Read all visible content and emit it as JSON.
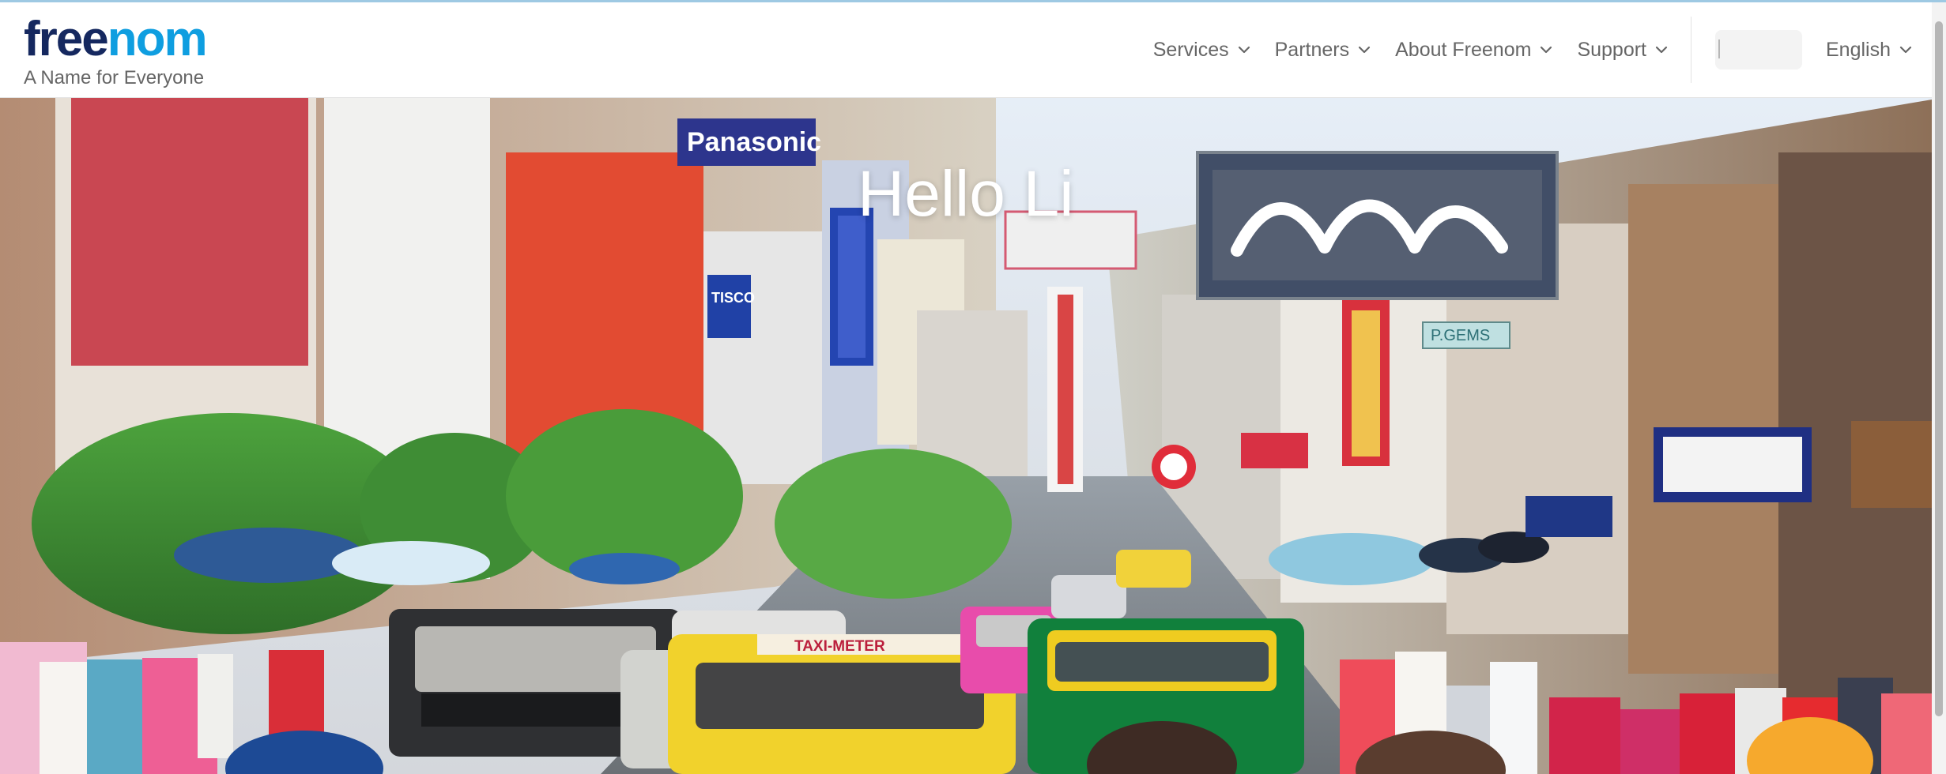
{
  "header": {
    "logo": {
      "part1": "free",
      "part2": "nom"
    },
    "tagline": "A Name for Everyone",
    "nav": {
      "items": [
        {
          "label": "Services",
          "icon": "chevron-down-icon"
        },
        {
          "label": "Partners",
          "icon": "chevron-down-icon"
        },
        {
          "label": "About Freenom",
          "icon": "chevron-down-icon"
        },
        {
          "label": "Support",
          "icon": "chevron-down-icon"
        }
      ],
      "language": {
        "label": "English",
        "icon": "chevron-down-icon"
      }
    }
  },
  "hero": {
    "headline": "Hello Li"
  },
  "signs": {
    "panasonic": "Panasonic",
    "tisco": "TISCO",
    "taxi_meter": "TAXI-METER",
    "pgems": "P.GEMS"
  },
  "colors": {
    "logo_dark": "#15285f",
    "logo_light": "#0f9ee0",
    "nav_text": "#666666"
  }
}
